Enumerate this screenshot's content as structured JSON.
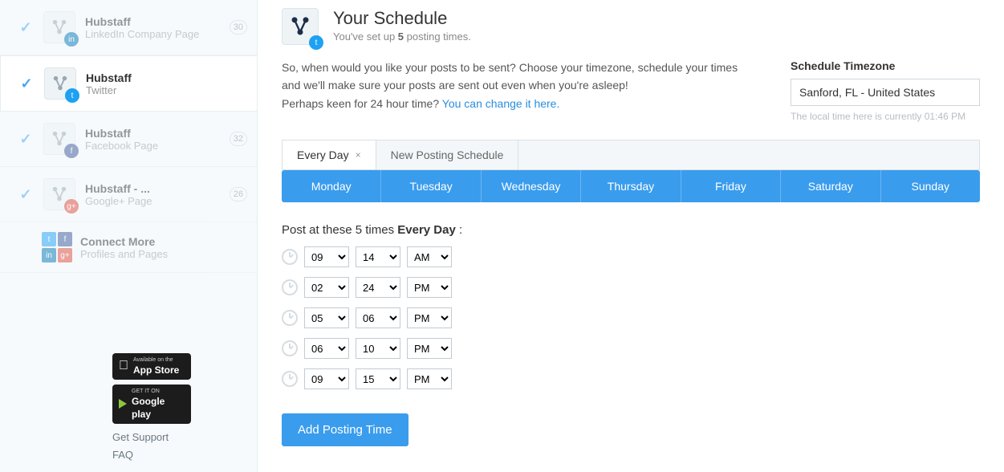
{
  "sidebar": {
    "accounts": [
      {
        "name": "Hubstaff",
        "sub": "LinkedIn Company Page",
        "network": "li",
        "count": "30",
        "checked": true,
        "faded": true
      },
      {
        "name": "Hubstaff",
        "sub": "Twitter",
        "network": "tw",
        "count": "",
        "checked": true,
        "faded": false,
        "active": true
      },
      {
        "name": "Hubstaff",
        "sub": "Facebook Page",
        "network": "fb",
        "count": "32",
        "checked": true,
        "faded": true
      },
      {
        "name": "Hubstaff - ...",
        "sub": "Google+ Page",
        "network": "gp",
        "count": "26",
        "checked": true,
        "faded": true
      }
    ],
    "connect": {
      "name": "Connect More",
      "sub": "Profiles and Pages"
    },
    "store": {
      "apple_small": "Available on the",
      "apple_big": "App Store",
      "google_small": "GET IT ON",
      "google_big": "Google play"
    },
    "links": {
      "support": "Get Support",
      "faq": "FAQ"
    }
  },
  "header": {
    "title": "Your Schedule",
    "sub_pre": "You've set up ",
    "sub_count": "5",
    "sub_post": " posting times."
  },
  "intro": {
    "p1": "So, when would you like your posts to be sent? Choose your timezone, schedule your times and we'll make sure your posts are sent out even when you're asleep!",
    "p2_pre": "Perhaps keen for 24 hour time? ",
    "p2_link": "You can change it here."
  },
  "timezone": {
    "label": "Schedule Timezone",
    "value": "Sanford, FL - United States",
    "note": "The local time here is currently 01:46 PM"
  },
  "tabs": {
    "everyday": "Every Day",
    "new": "New Posting Schedule"
  },
  "days": [
    "Monday",
    "Tuesday",
    "Wednesday",
    "Thursday",
    "Friday",
    "Saturday",
    "Sunday"
  ],
  "post_label": {
    "pre": "Post at these 5 times ",
    "bold": "Every Day",
    "post": " :"
  },
  "times": [
    {
      "h": "09",
      "m": "14",
      "ap": "AM"
    },
    {
      "h": "02",
      "m": "24",
      "ap": "PM"
    },
    {
      "h": "05",
      "m": "06",
      "ap": "PM"
    },
    {
      "h": "06",
      "m": "10",
      "ap": "PM"
    },
    {
      "h": "09",
      "m": "15",
      "ap": "PM"
    }
  ],
  "add_button": "Add Posting Time"
}
